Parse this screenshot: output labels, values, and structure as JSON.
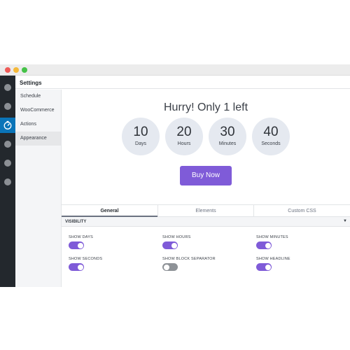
{
  "window": {
    "controls": [
      "close",
      "minimize",
      "zoom"
    ]
  },
  "leftbar": {
    "icons": [
      "menu-dot-icon",
      "menu-dot-icon",
      "timer-icon",
      "menu-dot-icon",
      "menu-dot-icon",
      "menu-dot-icon"
    ],
    "active_index": 2
  },
  "settings": {
    "title": "Settings",
    "menu": [
      {
        "label": "Schedule"
      },
      {
        "label": "WooCommerce"
      },
      {
        "label": "Actions"
      },
      {
        "label": "Appearance"
      }
    ],
    "active_menu": "Appearance"
  },
  "preview": {
    "headline": "Hurry! Only 1 left",
    "countdown": [
      {
        "value": "10",
        "label": "Days"
      },
      {
        "value": "20",
        "label": "Hours"
      },
      {
        "value": "30",
        "label": "Minutes"
      },
      {
        "value": "40",
        "label": "Seconds"
      }
    ],
    "button_label": "Buy Now",
    "accent_color": "#7f5bd8"
  },
  "tabs": [
    {
      "label": "General",
      "active": true
    },
    {
      "label": "Elements",
      "active": false
    },
    {
      "label": "Custom CSS",
      "active": false
    }
  ],
  "visibility": {
    "title": "VISIBILITY",
    "options": [
      {
        "label": "SHOW DAYS",
        "on": true
      },
      {
        "label": "SHOW HOURS",
        "on": true
      },
      {
        "label": "SHOW MINUTES",
        "on": true
      },
      {
        "label": "SHOW SECONDS",
        "on": true
      },
      {
        "label": "SHOW BLOCK SEPARATOR",
        "on": false
      },
      {
        "label": "SHOW HEADLINE",
        "on": true
      }
    ]
  }
}
